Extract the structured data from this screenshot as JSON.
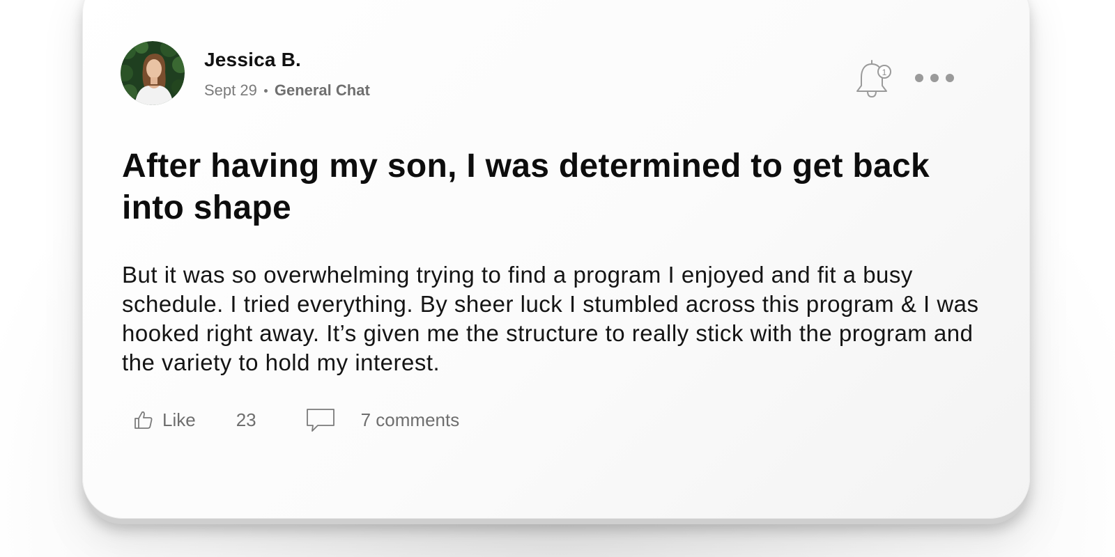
{
  "post": {
    "author": "Jessica B.",
    "date": "Sept 29",
    "channel": "General Chat",
    "title": "After having my son, I was determined to get back into shape",
    "body": "But it was so overwhelming trying to find a program I enjoyed and fit a busy schedule. I tried everything. By sheer luck I stumbled across this program & I was hooked right away. It’s given me the structure to really stick with the program and the variety to hold my interest.",
    "notification_count": "1",
    "like_label": "Like",
    "like_count": "23",
    "comments_label": "7 comments"
  },
  "icons": {
    "bell": "bell-icon",
    "more": "more-horizontal-icon",
    "like": "thumbs-up-icon",
    "comment": "speech-bubble-icon"
  },
  "colors": {
    "text_primary": "#111111",
    "text_secondary": "#7a7a7a",
    "icon_gray": "#9a9a9a"
  }
}
